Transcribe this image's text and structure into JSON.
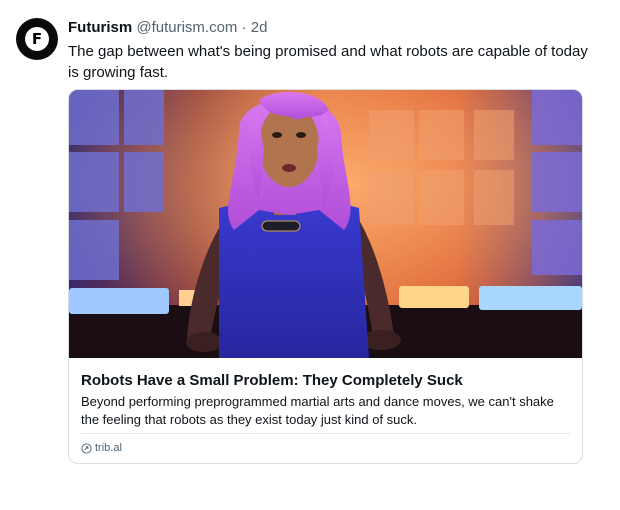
{
  "tweet": {
    "author_name": "Futurism",
    "handle": "@futurism.com",
    "separator": "·",
    "time": "2d",
    "text": "The gap between what's being promised and what robots are capable of today is growing fast.",
    "avatar_letter": "F"
  },
  "link_card": {
    "title": "Robots Have a Small Problem: They Completely Suck",
    "description": "Beyond performing preprogrammed martial arts and dance moves, we can't shake the feeling that robots as they exist today just kind of suck.",
    "domain": "trib.al",
    "image_description_icon": "link-icon"
  },
  "colors": {
    "text_primary": "#0f1419",
    "text_secondary": "#536471",
    "card_border": "#d9dde1"
  }
}
